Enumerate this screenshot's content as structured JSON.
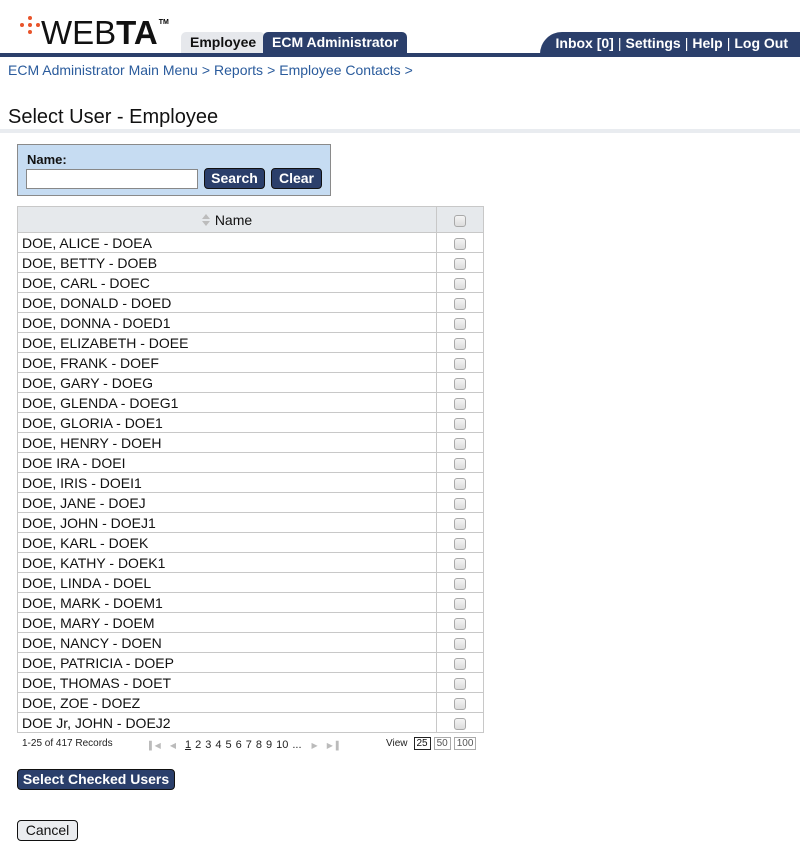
{
  "header": {
    "logo": {
      "text_light": "WEB",
      "text_bold": "TA",
      "trademark": "TM"
    },
    "tabs": [
      {
        "label": "Employee",
        "active": false
      },
      {
        "label": "ECM Administrator",
        "active": true
      }
    ],
    "util_links": [
      {
        "label": "Inbox [0]"
      },
      {
        "label": "Settings"
      },
      {
        "label": "Help"
      },
      {
        "label": "Log Out"
      }
    ],
    "util_separator": "|"
  },
  "breadcrumb": {
    "items": [
      {
        "label": "ECM Administrator Main Menu"
      },
      {
        "label": "Reports"
      },
      {
        "label": "Employee Contacts"
      }
    ],
    "separator": ">"
  },
  "page": {
    "title": "Select User - Employee"
  },
  "search": {
    "label": "Name:",
    "value": "",
    "placeholder": "",
    "search_button": "Search",
    "clear_button": "Clear"
  },
  "table": {
    "columns": [
      {
        "label": "Name",
        "sortable": true,
        "sort_icon": "sort-icon"
      },
      {
        "label": "",
        "type": "select-all-checkbox"
      }
    ],
    "rows": [
      {
        "name": "DOE, ALICE - DOEA",
        "checked": false
      },
      {
        "name": "DOE, BETTY - DOEB",
        "checked": false
      },
      {
        "name": "DOE, CARL - DOEC",
        "checked": false
      },
      {
        "name": "DOE, DONALD - DOED",
        "checked": false
      },
      {
        "name": "DOE, DONNA - DOED1",
        "checked": false
      },
      {
        "name": "DOE, ELIZABETH - DOEE",
        "checked": false
      },
      {
        "name": "DOE, FRANK - DOEF",
        "checked": false
      },
      {
        "name": "DOE, GARY - DOEG",
        "checked": false
      },
      {
        "name": "DOE, GLENDA - DOEG1",
        "checked": false
      },
      {
        "name": "DOE, GLORIA - DOE1",
        "checked": false
      },
      {
        "name": "DOE, HENRY - DOEH",
        "checked": false
      },
      {
        "name": "DOE IRA - DOEI",
        "checked": false
      },
      {
        "name": "DOE, IRIS - DOEI1",
        "checked": false
      },
      {
        "name": "DOE, JANE - DOEJ",
        "checked": false
      },
      {
        "name": "DOE, JOHN - DOEJ1",
        "checked": false
      },
      {
        "name": "DOE, KARL - DOEK",
        "checked": false
      },
      {
        "name": "DOE, KATHY - DOEK1",
        "checked": false
      },
      {
        "name": "DOE, LINDA - DOEL",
        "checked": false
      },
      {
        "name": "DOE, MARK - DOEM1",
        "checked": false
      },
      {
        "name": "DOE, MARY - DOEM",
        "checked": false
      },
      {
        "name": "DOE, NANCY - DOEN",
        "checked": false
      },
      {
        "name": "DOE, PATRICIA - DOEP",
        "checked": false
      },
      {
        "name": "DOE, THOMAS - DOET",
        "checked": false
      },
      {
        "name": "DOE, ZOE - DOEZ",
        "checked": false
      },
      {
        "name": "DOE Jr, JOHN - DOEJ2",
        "checked": false
      }
    ]
  },
  "pagination": {
    "records_text": "1-25 of 417 Records",
    "pages": [
      "1",
      "2",
      "3",
      "4",
      "5",
      "6",
      "7",
      "8",
      "9",
      "10"
    ],
    "current_page": "1",
    "ellipsis": "...",
    "icons": {
      "first": "first-page-icon",
      "prev": "prev-page-icon",
      "next": "next-page-icon",
      "last": "last-page-icon"
    },
    "view_label": "View",
    "page_sizes": [
      "25",
      "50",
      "100"
    ],
    "selected_page_size": "25"
  },
  "actions": {
    "select_checked": "Select Checked Users",
    "cancel": "Cancel"
  },
  "colors": {
    "brand_navy": "#2b3f6b",
    "logo_orange": "#e8542b",
    "link_blue": "#2a5b9c",
    "search_panel_bg": "#c6dcf2",
    "table_header_bg": "#e6e9ec"
  }
}
